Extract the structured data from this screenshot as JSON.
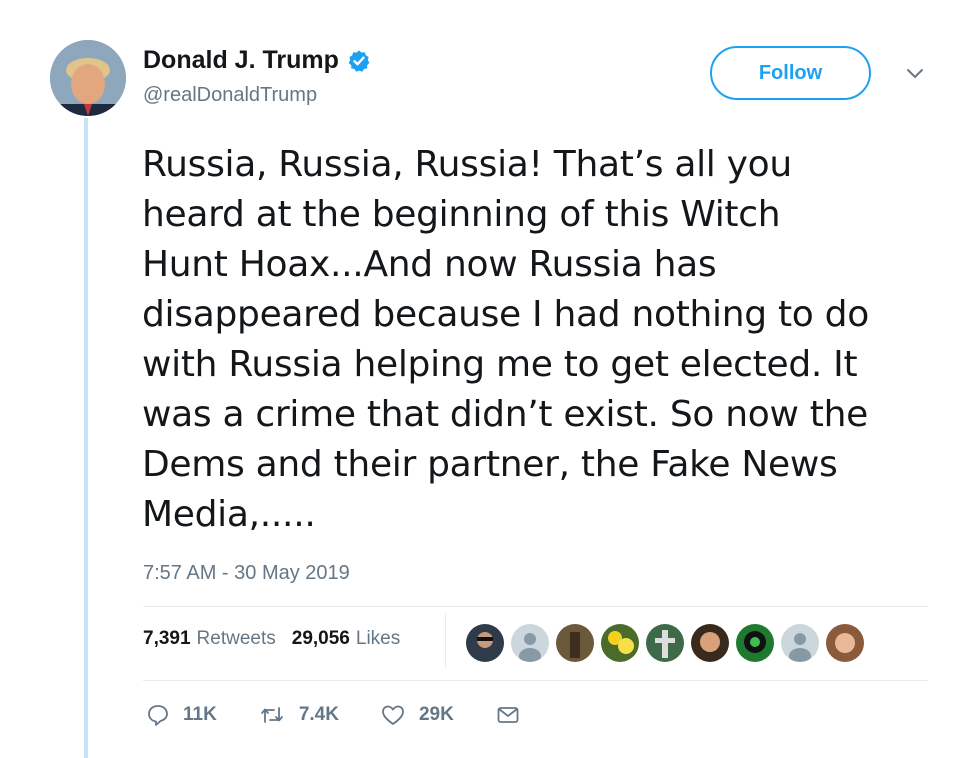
{
  "author": {
    "name": "Donald J. Trump",
    "handle": "@realDonaldTrump",
    "verified": true
  },
  "follow_button": {
    "label": "Follow"
  },
  "tweet": {
    "lines": [
      "Russia, Russia, Russia! That’s all you",
      "heard at the beginning of this Witch",
      "Hunt Hoax...And now Russia has",
      "disappeared because I had nothing to do",
      "with Russia helping me to get elected. It",
      "was a crime that didn’t exist. So now the",
      "Dems and their partner, the Fake News",
      "Media,....."
    ],
    "timestamp": "7:57 AM - 30 May 2019"
  },
  "stats": {
    "retweets_count": "7,391",
    "retweets_label": "Retweets",
    "likes_count": "29,056",
    "likes_label": "Likes"
  },
  "actions": {
    "reply_count": "11K",
    "retweet_count": "7.4K",
    "like_count": "29K"
  },
  "colors": {
    "accent": "#1da1f2",
    "muted": "#657786",
    "thread": "#c4e4f7"
  }
}
